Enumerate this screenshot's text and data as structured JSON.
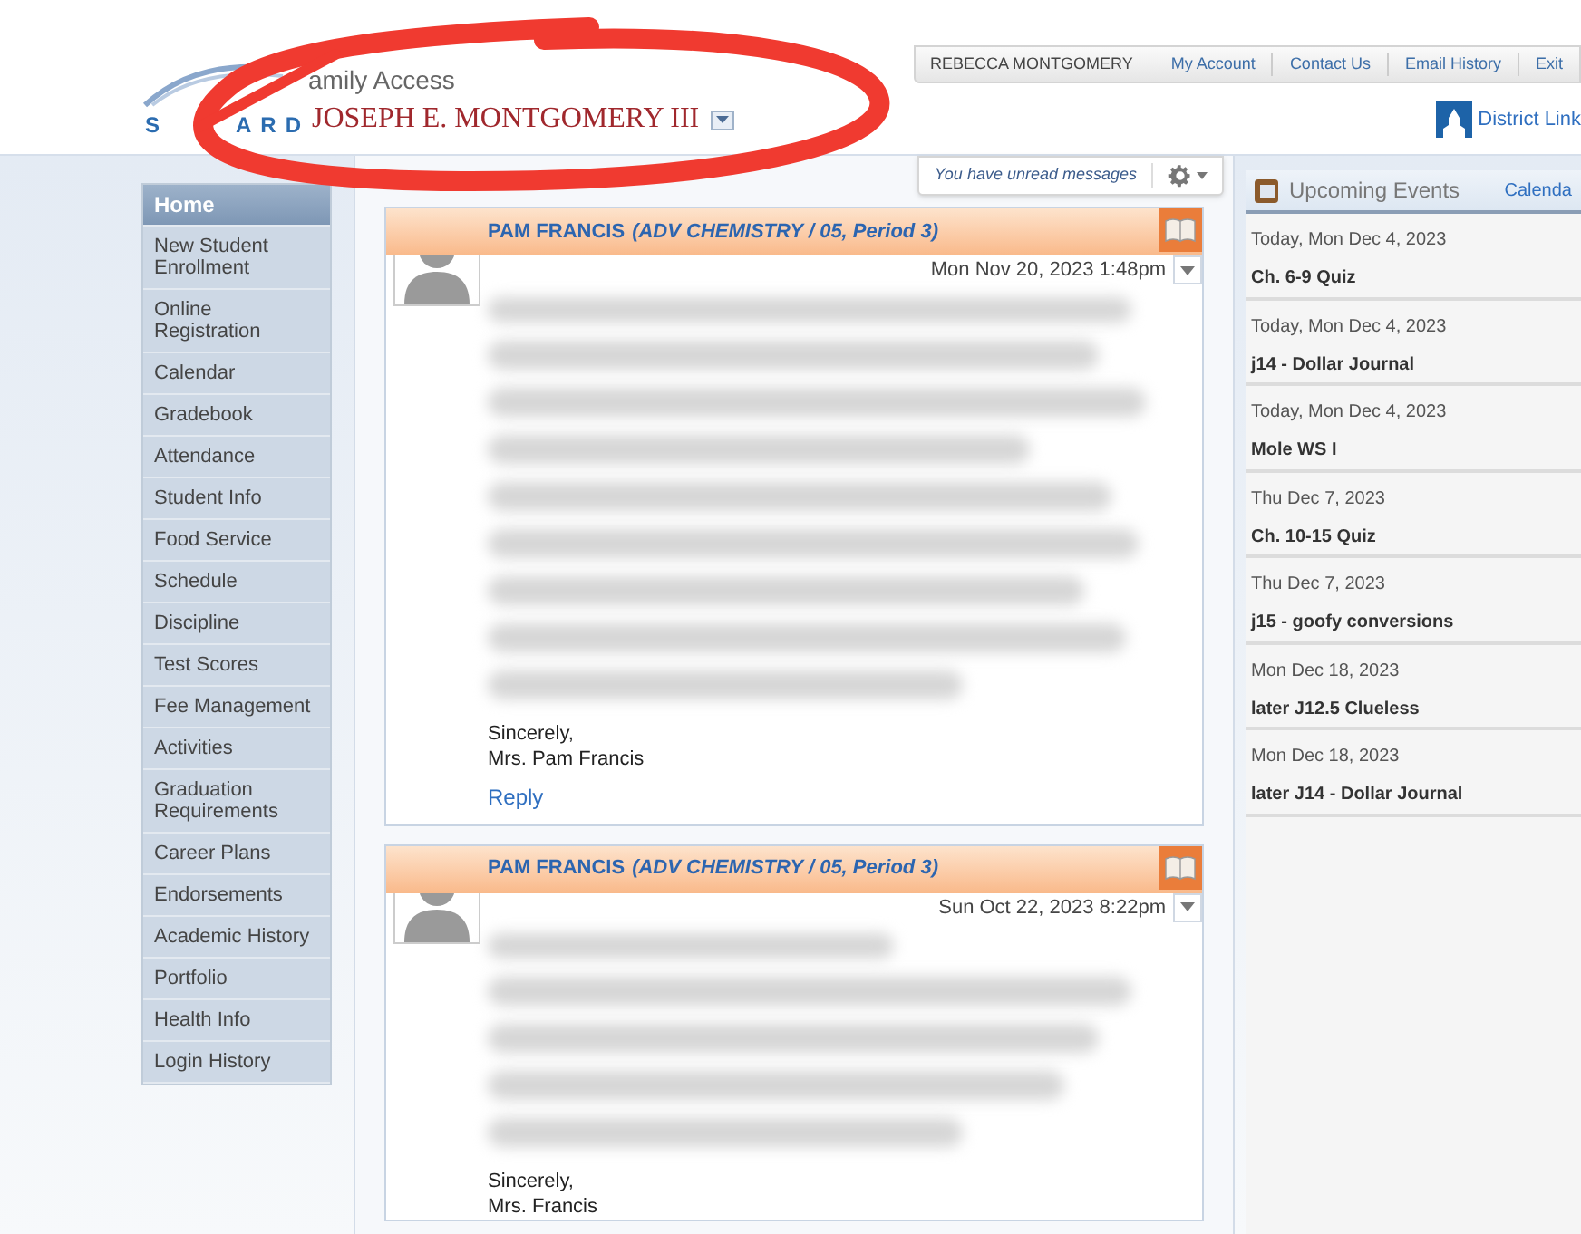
{
  "header": {
    "logo_texts": [
      "S",
      "ARD"
    ],
    "app_name": "amily Access",
    "student_name": "JOSEPH E. MONTGOMERY III",
    "user_name": "REBECCA MONTGOMERY",
    "top_links": [
      "My Account",
      "Contact Us",
      "Email History",
      "Exit"
    ],
    "district_link": "District Link"
  },
  "sidebar": {
    "items": [
      {
        "label": "Home",
        "selected": true
      },
      {
        "label": "New Student Enrollment",
        "selected": false
      },
      {
        "label": "Online Registration",
        "selected": false
      },
      {
        "label": "Calendar",
        "selected": false
      },
      {
        "label": "Gradebook",
        "selected": false
      },
      {
        "label": "Attendance",
        "selected": false
      },
      {
        "label": "Student Info",
        "selected": false
      },
      {
        "label": "Food Service",
        "selected": false
      },
      {
        "label": "Schedule",
        "selected": false
      },
      {
        "label": "Discipline",
        "selected": false
      },
      {
        "label": "Test Scores",
        "selected": false
      },
      {
        "label": "Fee Management",
        "selected": false
      },
      {
        "label": "Activities",
        "selected": false
      },
      {
        "label": "Graduation Requirements",
        "selected": false
      },
      {
        "label": "Career Plans",
        "selected": false
      },
      {
        "label": "Endorsements",
        "selected": false
      },
      {
        "label": "Academic History",
        "selected": false
      },
      {
        "label": "Portfolio",
        "selected": false
      },
      {
        "label": "Health Info",
        "selected": false
      },
      {
        "label": "Login History",
        "selected": false
      }
    ]
  },
  "messages_toolbar": {
    "notice": "You have unread messages"
  },
  "messages": [
    {
      "sender": "PAM FRANCIS",
      "course": "(ADV CHEMISTRY / 05, Period 3)",
      "date": "Mon Nov 20, 2023 1:48pm",
      "closing": "Sincerely,",
      "signature": "Mrs. Pam Francis",
      "reply": "Reply"
    },
    {
      "sender": "PAM FRANCIS",
      "course": "(ADV CHEMISTRY / 05, Period 3)",
      "date": "Sun Oct 22, 2023 8:22pm",
      "closing": "Sincerely,",
      "signature": "Mrs. Francis"
    }
  ],
  "upcoming_events": {
    "title": "Upcoming Events",
    "calendar_link": "Calenda",
    "events": [
      {
        "date": "Today, Mon Dec 4, 2023",
        "title": "Ch. 6-9 Quiz"
      },
      {
        "date": "Today, Mon Dec 4, 2023",
        "title": "j14 - Dollar Journal"
      },
      {
        "date": "Today, Mon Dec 4, 2023",
        "title": "Mole WS I"
      },
      {
        "date": "Thu Dec 7, 2023",
        "title": "Ch. 10-15 Quiz"
      },
      {
        "date": "Thu Dec 7, 2023",
        "title": "j15 - goofy conversions"
      },
      {
        "date": "Mon Dec 18, 2023",
        "title": "later J12.5 Clueless"
      },
      {
        "date": "Mon Dec 18, 2023",
        "title": "later J14 - Dollar Journal"
      }
    ]
  }
}
